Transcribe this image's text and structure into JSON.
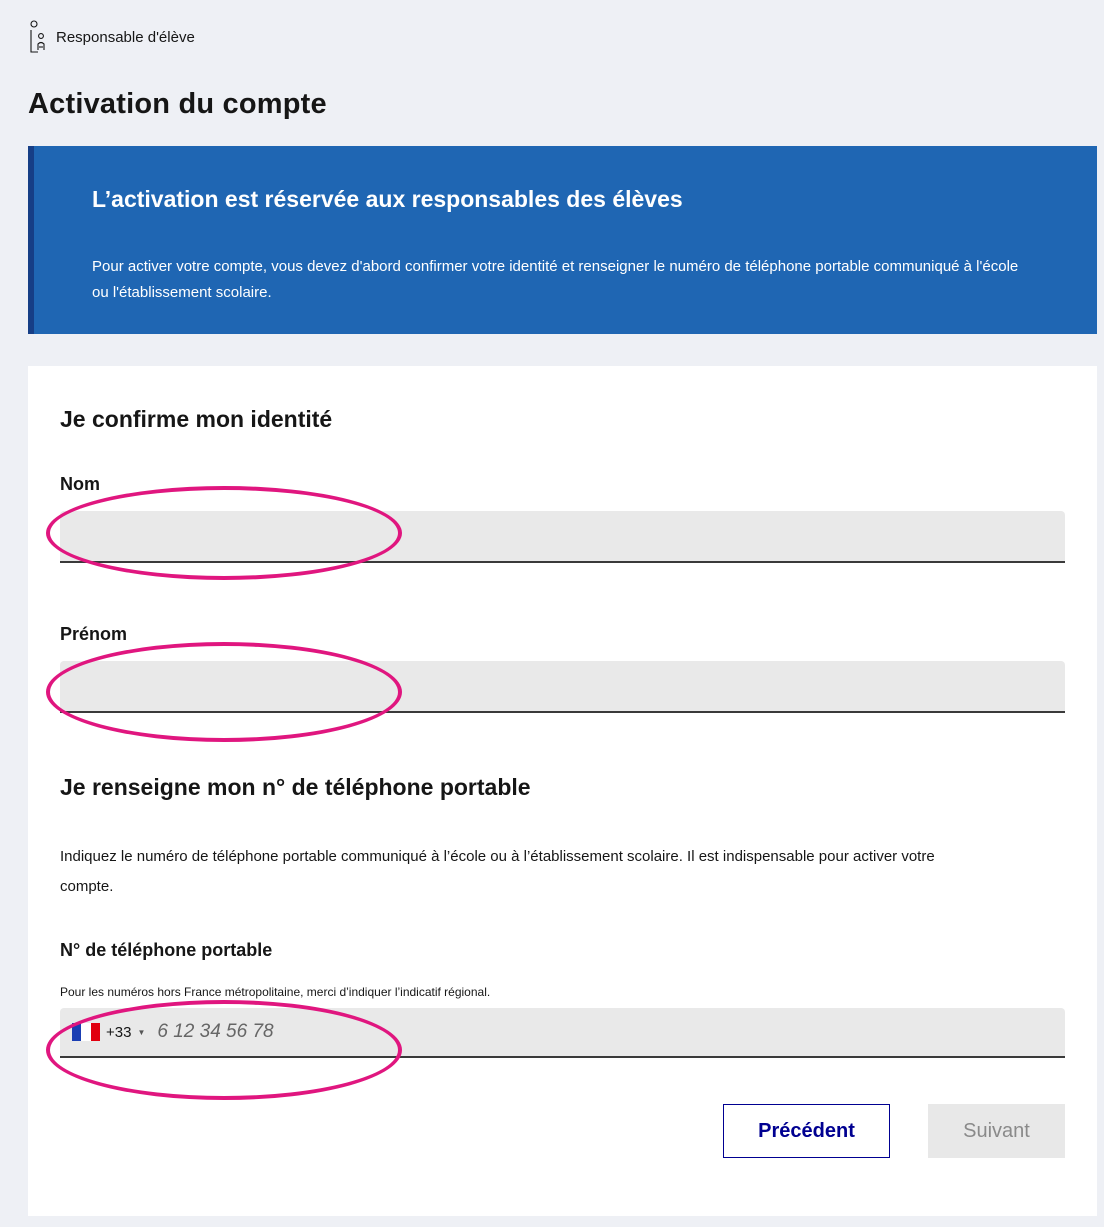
{
  "header": {
    "role_label": "Responsable d'élève",
    "role_icon": "parent-child-icon"
  },
  "page_title": "Activation du compte",
  "callout": {
    "title": "L’activation est réservée aux responsables des élèves",
    "text": "Pour activer votre compte, vous devez d'abord confirmer votre identité et renseigner le numéro de téléphone portable communiqué à l'école ou l'établissement scolaire.",
    "background_color": "#1f66b3"
  },
  "identity": {
    "title": "Je confirme mon identité",
    "nom_label": "Nom",
    "nom_value": "",
    "prenom_label": "Prénom",
    "prenom_value": ""
  },
  "phone_section": {
    "title": "Je renseigne mon n° de téléphone portable",
    "description": "Indiquez le numéro de téléphone portable communiqué à l’école ou à l’établissement scolaire. Il est indispensable pour activer votre compte.",
    "field_label": "N° de téléphone portable",
    "hint": "Pour les numéros hors France métropolitaine, merci d’indiquer l’indicatif régional.",
    "country_flag": "france-flag-icon",
    "dial_code": "+33",
    "placeholder": "6 12 34 56 78",
    "value": ""
  },
  "actions": {
    "previous_label": "Précédent",
    "next_label": "Suivant"
  },
  "colors": {
    "accent": "#000091",
    "highlight": "#e0167f",
    "page_background": "#eef0f5"
  }
}
